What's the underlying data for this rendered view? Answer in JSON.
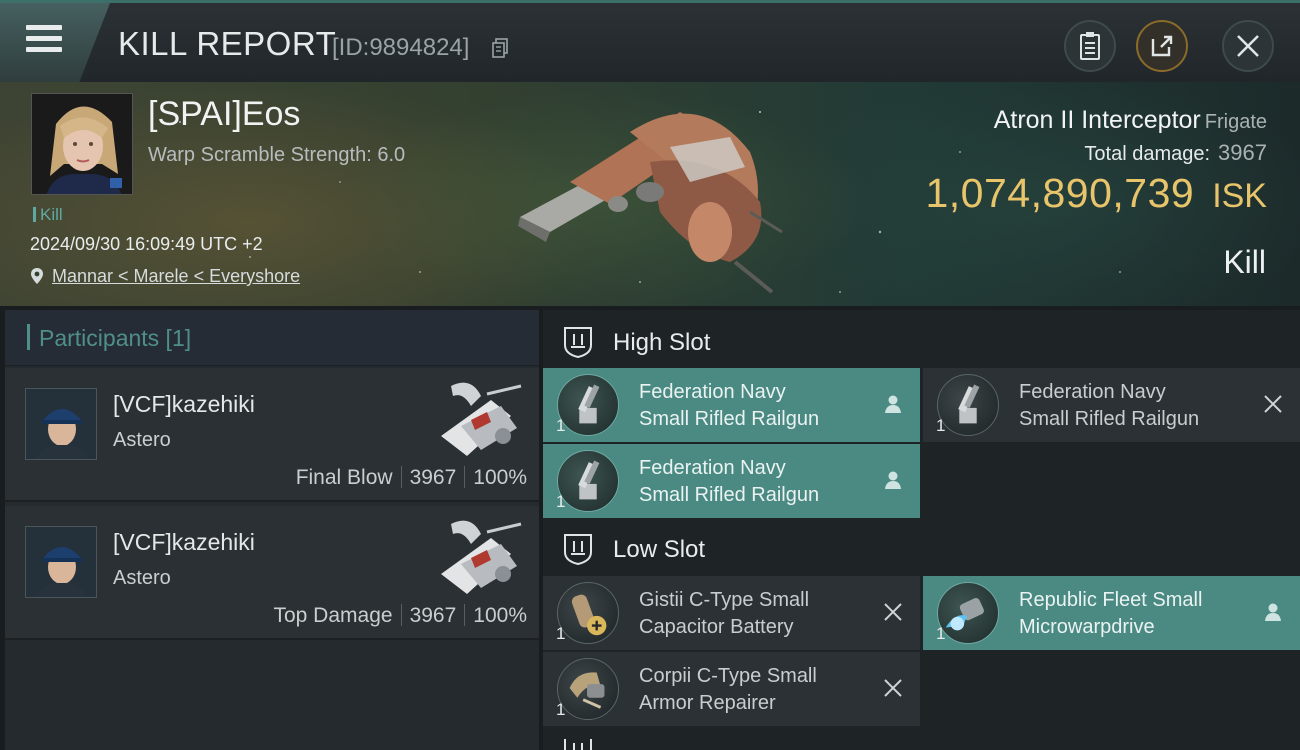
{
  "header": {
    "title": "KILL REPORT",
    "report_id": "[ID:9894824]"
  },
  "victim": {
    "pilot": "[SPAI]Eos",
    "warp_scramble": "Warp Scramble Strength: 6.0",
    "kill_tag": "Kill",
    "datetime": "2024/09/30 16:09:49 UTC +2",
    "location": "Mannar < Marele < Everyshore",
    "ship_name": "Atron II Interceptor",
    "ship_class": "Frigate",
    "total_damage_label": "Total damage:",
    "total_damage": "3967",
    "isk_value": "1,074,890,739",
    "isk_unit": "ISK",
    "result": "Kill"
  },
  "participants": {
    "title": "Participants [1]",
    "rows": [
      {
        "name": "[VCF]kazehiki",
        "ship": "Astero",
        "role": "Final Blow",
        "damage": "3967",
        "percent": "100%"
      },
      {
        "name": "[VCF]kazehiki",
        "ship": "Astero",
        "role": "Top Damage",
        "damage": "3967",
        "percent": "100%"
      }
    ]
  },
  "fitting": {
    "high_slot_label": "High Slot",
    "low_slot_label": "Low Slot",
    "high": [
      {
        "name_line1": "Federation Navy",
        "name_line2": "Small Rifled Railgun",
        "qty": "1",
        "state": "fitted"
      },
      {
        "name_line1": "Federation Navy",
        "name_line2": "Small Rifled Railgun",
        "qty": "1",
        "state": "destroyed"
      },
      {
        "name_line1": "Federation Navy",
        "name_line2": "Small Rifled Railgun",
        "qty": "1",
        "state": "fitted"
      }
    ],
    "low": [
      {
        "name_line1": "Gistii C-Type Small",
        "name_line2": "Capacitor Battery",
        "qty": "1",
        "state": "destroyed"
      },
      {
        "name_line1": "Republic Fleet Small",
        "name_line2": "Microwarpdrive",
        "qty": "1",
        "state": "fitted"
      },
      {
        "name_line1": "Corpii C-Type Small",
        "name_line2": "Armor Repairer",
        "qty": "1",
        "state": "destroyed"
      }
    ]
  },
  "colors": {
    "accent": "#4f8f8a",
    "fitted_bg": "#4a8a83",
    "isk_gold": "#e8c46a"
  },
  "icons": {
    "menu": "hamburger-icon",
    "copy": "copy-icon",
    "clipboard": "clipboard-icon",
    "share": "share-icon",
    "close": "close-icon",
    "location": "map-pin-icon",
    "slot": "shield-slot-icon",
    "pilot_status": "person-icon",
    "destroyed": "x-icon"
  }
}
